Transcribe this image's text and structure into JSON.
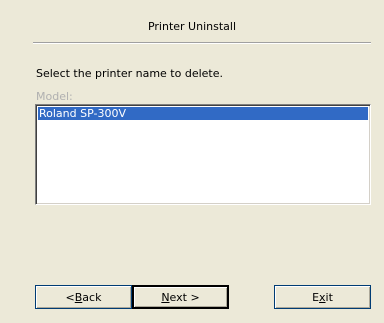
{
  "header": {
    "title": "Printer Uninstall"
  },
  "main": {
    "prompt": "Select the printer name to delete.",
    "model_label": "Model:",
    "models": [
      {
        "label": "Roland SP-300V",
        "selected": true
      }
    ]
  },
  "buttons": {
    "back": {
      "pre": "< ",
      "key": "B",
      "post": "ack"
    },
    "next": {
      "pre": "",
      "key": "N",
      "post": "ext >"
    },
    "exit": {
      "pre": "E",
      "key": "x",
      "post": "it"
    }
  },
  "colors": {
    "selection": "#316ac5",
    "dialog_bg": "#ece9d8"
  }
}
